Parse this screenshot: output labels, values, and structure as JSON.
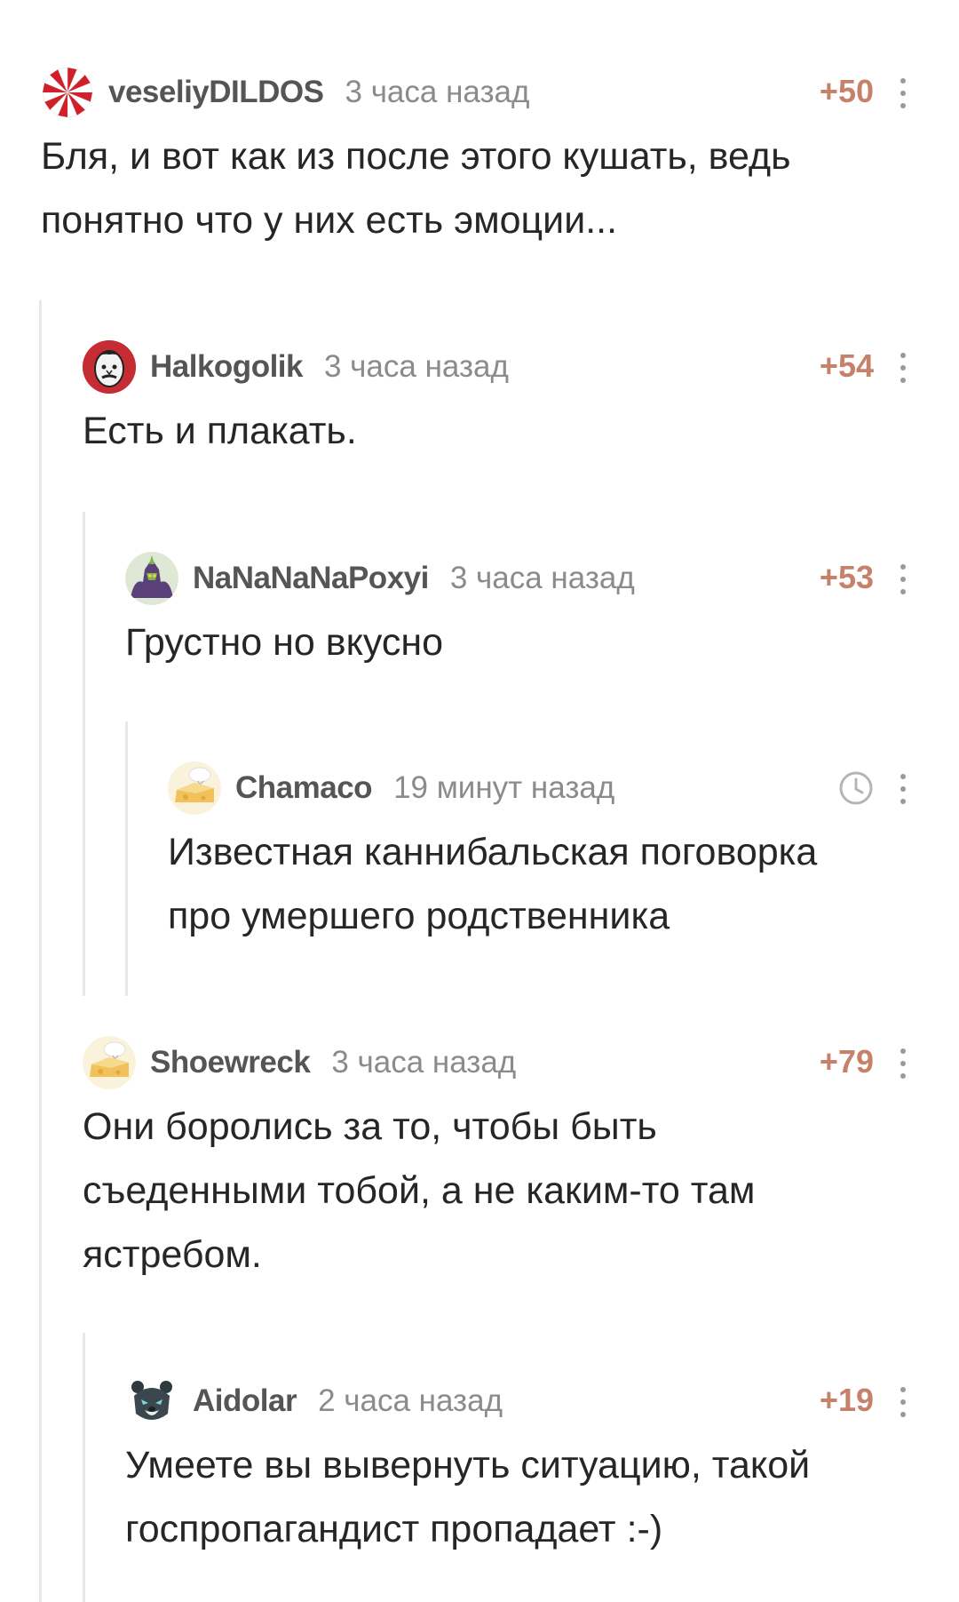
{
  "comments": [
    {
      "author": "veseliyDILDOS",
      "time": "3 часа назад",
      "rating": "+50",
      "avatar_icon": "umbrella-logo-icon",
      "lines": [
        "Бля, и вот как из после этого кушать, ведь",
        "понятно что у них есть эмоции..."
      ]
    },
    {
      "author": "Halkogolik",
      "time": "3 часа назад",
      "rating": "+54",
      "avatar_icon": "man-portrait-icon",
      "lines": [
        "Есть и плакать."
      ]
    },
    {
      "author": "NaNaNaNaPoxyi",
      "time": "3 часа назад",
      "rating": "+53",
      "avatar_icon": "robot-avatar-icon",
      "lines": [
        "Грустно но вкусно"
      ]
    },
    {
      "author": "Chamaco",
      "time": "19 минут назад",
      "rating_icon": "clock-icon",
      "avatar_icon": "cheese-avatar-icon",
      "lines": [
        "Известная каннибальская поговорка",
        "про умершего родственника"
      ]
    },
    {
      "author": "Shoewreck",
      "time": "3 часа назад",
      "rating": "+79",
      "avatar_icon": "cheese-avatar-icon",
      "lines": [
        "Они боролись за то, чтобы быть",
        "съеденными тобой, а не каким-то там",
        "ястребом."
      ]
    },
    {
      "author": "Aidolar",
      "time": "2 часа назад",
      "rating": "+19",
      "avatar_icon": "bear-avatar-icon",
      "lines": [
        "Умеете вы вывернуть ситуацию, такой",
        "госпропагандист пропадает :-)"
      ]
    }
  ],
  "colors": {
    "rating": "#c6816b",
    "thread_line": "#e8e8e8",
    "author": "#555555",
    "time": "#8b8b8b"
  }
}
